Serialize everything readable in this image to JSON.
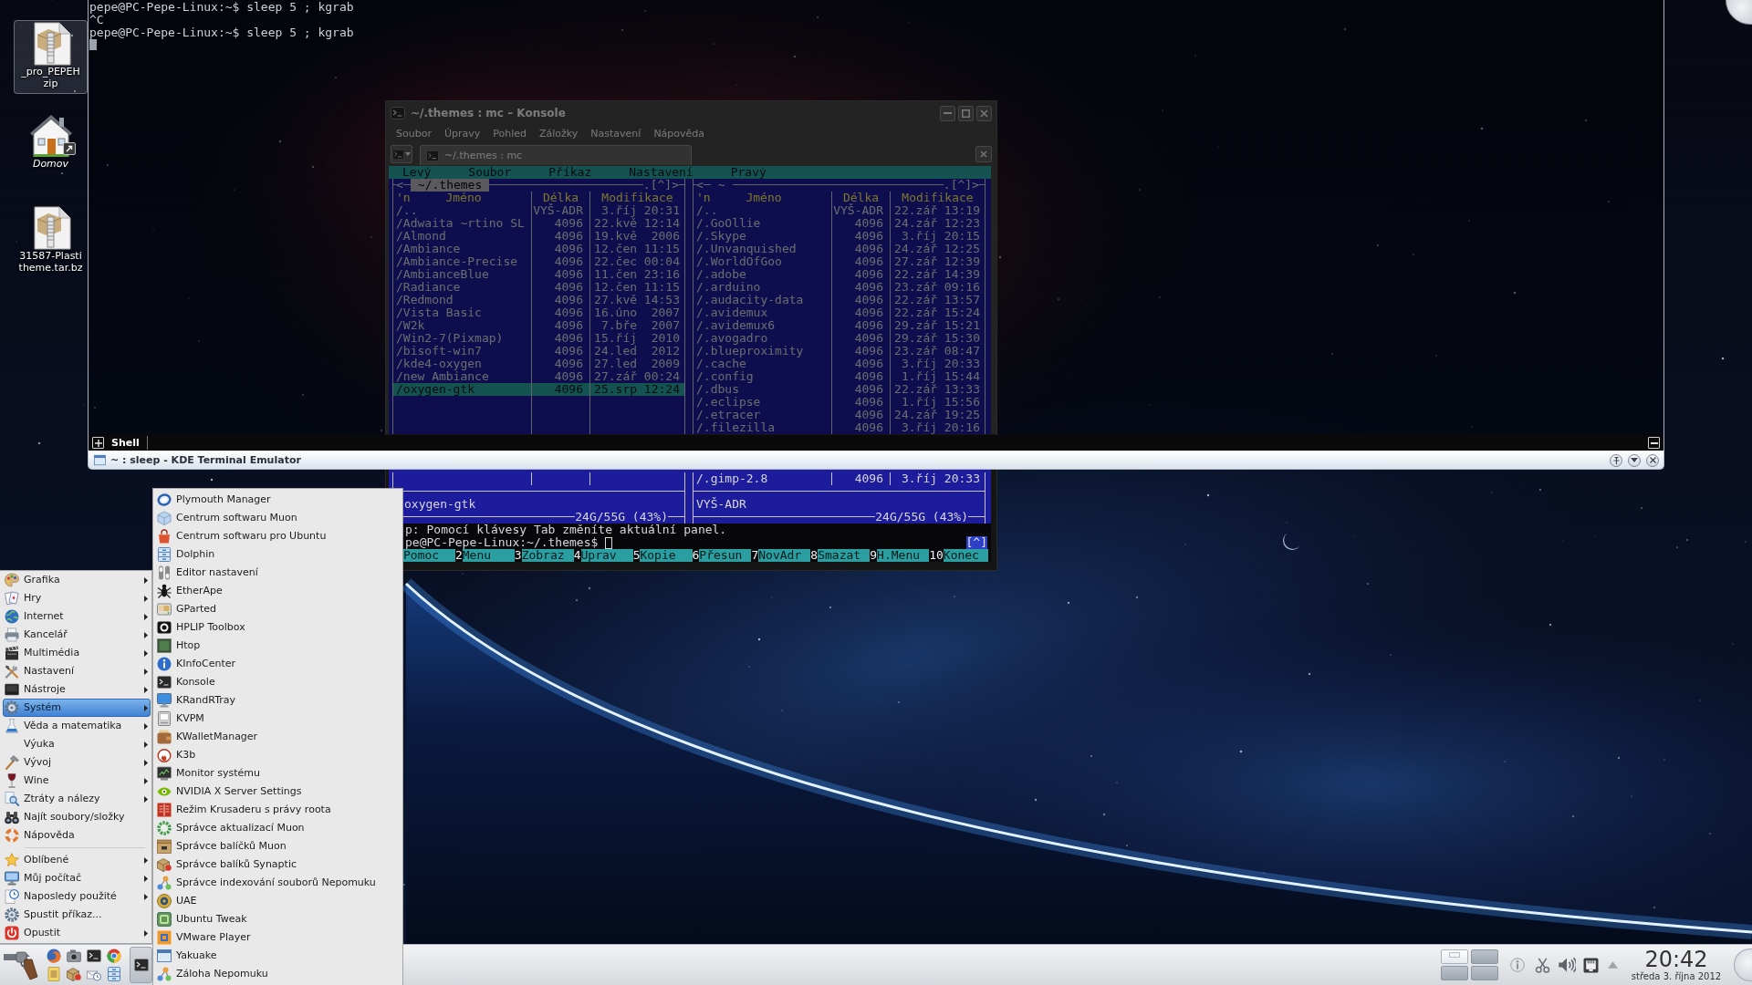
{
  "desktop": {
    "icons": [
      {
        "kind": "archive",
        "label_lines": [
          "_pro_PEPEH",
          "zip"
        ],
        "selected": true,
        "link": false
      },
      {
        "kind": "home",
        "label_lines": [
          "Domov"
        ],
        "selected": false,
        "link": true
      },
      {
        "kind": "archive",
        "label_lines": [
          "31587-Plasti",
          "theme.tar.bz"
        ],
        "selected": false,
        "link": false
      }
    ]
  },
  "yakuake": {
    "terminal_lines": [
      "pepe@PC-Pepe-Linux:~$ sleep 5 ; kgrab",
      "^C",
      "pepe@PC-Pepe-Linux:~$ sleep 5 ; kgrab"
    ],
    "tabs": [
      {
        "label": "Shell",
        "selected": true
      }
    ],
    "title": "~ : sleep - KDE Terminal Emulator"
  },
  "konsole": {
    "title": "~/.themes : mc – Konsole",
    "menu": [
      "Soubor",
      "Úpravy",
      "Pohled",
      "Záložky",
      "Nastavení",
      "Nápověda"
    ],
    "tabs": [
      {
        "label": "~/.themes : mc",
        "selected": true
      }
    ],
    "mc": {
      "menu": [
        "Levý",
        "Soubor",
        "Příkaz",
        "Nastavení",
        "Pravý"
      ],
      "panels": [
        {
          "corner_left": "<",
          "path": "~/.themes",
          "active": true,
          "corner_right": ".[^]>",
          "columns": [
            "'n",
            "Jméno",
            "Délka",
            "Modifikace"
          ],
          "rows": [
            {
              "name": "/..",
              "size": "VYŠ-ADR",
              "modified": "3.říj 20:31",
              "selected": false
            },
            {
              "name": "/Adwaita ~rtino SL",
              "size": "4096",
              "modified": "22.kvě 12:14",
              "selected": false
            },
            {
              "name": "/Almond",
              "size": "4096",
              "modified": "19.kvě  2006",
              "selected": false
            },
            {
              "name": "/Ambiance",
              "size": "4096",
              "modified": "12.čen 11:15",
              "selected": false
            },
            {
              "name": "/Ambiance-Precise",
              "size": "4096",
              "modified": "22.čec 00:04",
              "selected": false
            },
            {
              "name": "/AmbianceBlue",
              "size": "4096",
              "modified": "11.čen 23:16",
              "selected": false
            },
            {
              "name": "/Radiance",
              "size": "4096",
              "modified": "12.čen 11:15",
              "selected": false
            },
            {
              "name": "/Redmond",
              "size": "4096",
              "modified": "27.kvě 14:53",
              "selected": false
            },
            {
              "name": "/Vista Basic",
              "size": "4096",
              "modified": "16.úno  2007",
              "selected": false
            },
            {
              "name": "/W2k",
              "size": "4096",
              "modified": "7.bře  2007",
              "selected": false
            },
            {
              "name": "/Win2-7(Pixmap)",
              "size": "4096",
              "modified": "15.říj  2010",
              "selected": false
            },
            {
              "name": "/bisoft-win7",
              "size": "4096",
              "modified": "24.led  2012",
              "selected": false
            },
            {
              "name": "/kde4-oxygen",
              "size": "4096",
              "modified": "27.led  2009",
              "selected": false
            },
            {
              "name": "/new Ambiance",
              "size": "4096",
              "modified": "27.zář 00:24",
              "selected": false
            },
            {
              "name": "/oxygen-gtk",
              "size": "4096",
              "modified": "25.srp 12:24",
              "selected": true
            }
          ],
          "mini_status": "oxygen-gtk",
          "disk_usage": "24G/55G (43%)"
        },
        {
          "corner_left": "<",
          "path": "~",
          "active": false,
          "corner_right": ".[^]>",
          "columns": [
            "'n",
            "Jméno",
            "Délka",
            "Modifikace"
          ],
          "rows": [
            {
              "name": "/..",
              "size": "VYŠ-ADR",
              "modified": "22.zář 13:19",
              "selected": false
            },
            {
              "name": "/.GoOllie",
              "size": "4096",
              "modified": "24.zář 12:23",
              "selected": false
            },
            {
              "name": "/.Skype",
              "size": "4096",
              "modified": "3.říj 20:15",
              "selected": false
            },
            {
              "name": "/.Unvanquished",
              "size": "4096",
              "modified": "24.zář 12:25",
              "selected": false
            },
            {
              "name": "/.WorldOfGoo",
              "size": "4096",
              "modified": "27.zář 12:39",
              "selected": false
            },
            {
              "name": "/.adobe",
              "size": "4096",
              "modified": "22.zář 14:39",
              "selected": false
            },
            {
              "name": "/.arduino",
              "size": "4096",
              "modified": "23.zář 09:16",
              "selected": false
            },
            {
              "name": "/.audacity-data",
              "size": "4096",
              "modified": "22.zář 13:57",
              "selected": false
            },
            {
              "name": "/.avidemux",
              "size": "4096",
              "modified": "22.zář 15:24",
              "selected": false
            },
            {
              "name": "/.avidemux6",
              "size": "4096",
              "modified": "29.zář 15:21",
              "selected": false
            },
            {
              "name": "/.avogadro",
              "size": "4096",
              "modified": "29.zář 15:30",
              "selected": false
            },
            {
              "name": "/.blueproximity",
              "size": "4096",
              "modified": "23.zář 08:47",
              "selected": false
            },
            {
              "name": "/.cache",
              "size": "4096",
              "modified": "3.říj 20:33",
              "selected": false
            },
            {
              "name": "/.config",
              "size": "4096",
              "modified": "1.říj 15:44",
              "selected": false
            },
            {
              "name": "/.dbus",
              "size": "4096",
              "modified": "22.zář 13:33",
              "selected": false
            },
            {
              "name": "/.eclipse",
              "size": "4096",
              "modified": "1.říj 15:56",
              "selected": false
            },
            {
              "name": "/.etracer",
              "size": "4096",
              "modified": "24.zář 19:25",
              "selected": false
            },
            {
              "name": "/.filezilla",
              "size": "4096",
              "modified": "3.říj 20:16",
              "selected": false
            }
          ],
          "rows_below_bar": [
            {
              "name": "/.gimp-2.8",
              "size": "4096",
              "modified": "3.říj 20:33",
              "selected": false
            }
          ],
          "mini_status": "VYŠ-ADR",
          "disk_usage": "24G/55G (43%)"
        }
      ],
      "hint": "p: Pomocí klávesy Tab změníte aktuální panel.",
      "prompt": "pe@PC-Pepe-Linux:~/.themes$",
      "history_marker": "[^]",
      "function_keys": [
        {
          "label": "Pomoc"
        },
        {
          "key": "2",
          "label": "Menu"
        },
        {
          "key": "3",
          "label": "Zobraz"
        },
        {
          "key": "4",
          "label": "Uprav"
        },
        {
          "key": "5",
          "label": "Kopie"
        },
        {
          "key": "6",
          "label": "Přesun"
        },
        {
          "key": "7",
          "label": "NovAdr"
        },
        {
          "key": "8",
          "label": "Smazat"
        },
        {
          "key": "9",
          "label": "H.Menu"
        },
        {
          "key": "10",
          "label": "Konec"
        }
      ]
    }
  },
  "start_menu": {
    "groups": [
      [
        {
          "label": "Grafika",
          "has_submenu": true,
          "selected": false
        },
        {
          "label": "Hry",
          "has_submenu": true,
          "selected": false
        },
        {
          "label": "Internet",
          "has_submenu": true,
          "selected": false
        },
        {
          "label": "Kancelář",
          "has_submenu": true,
          "selected": false
        },
        {
          "label": "Multimédia",
          "has_submenu": true,
          "selected": false
        },
        {
          "label": "Nastavení",
          "has_submenu": true,
          "selected": false
        },
        {
          "label": "Nástroje",
          "has_submenu": true,
          "selected": false
        },
        {
          "label": "Systém",
          "has_submenu": true,
          "selected": true
        },
        {
          "label": "Věda a matematika",
          "has_submenu": true,
          "selected": false
        },
        {
          "label": "Výuka",
          "has_submenu": true,
          "selected": false
        },
        {
          "label": "Vývoj",
          "has_submenu": true,
          "selected": false
        },
        {
          "label": "Wine",
          "has_submenu": true,
          "selected": false
        },
        {
          "label": "Ztráty a nálezy",
          "has_submenu": true,
          "selected": false
        },
        {
          "label": "Najít soubory/složky",
          "has_submenu": false,
          "selected": false
        },
        {
          "label": "Nápověda",
          "has_submenu": false,
          "selected": false
        }
      ],
      [
        {
          "label": "Oblíbené",
          "has_submenu": true,
          "selected": false
        },
        {
          "label": "Můj počítač",
          "has_submenu": true,
          "selected": false
        },
        {
          "label": "Naposledy použité",
          "has_submenu": true,
          "selected": false
        },
        {
          "label": "Spustit příkaz...",
          "has_submenu": false,
          "selected": false
        },
        {
          "label": "Opustit",
          "has_submenu": true,
          "selected": false
        }
      ]
    ],
    "submenu": [
      {
        "label": "Plymouth Manager",
        "selected": false
      },
      {
        "label": "Centrum softwaru Muon",
        "selected": false
      },
      {
        "label": "Centrum softwaru pro Ubuntu",
        "selected": false
      },
      {
        "label": "Dolphin",
        "selected": false
      },
      {
        "label": "Editor nastavení",
        "selected": false
      },
      {
        "label": "EtherApe",
        "selected": false
      },
      {
        "label": "GParted",
        "selected": false
      },
      {
        "label": "HPLIP Toolbox",
        "selected": false
      },
      {
        "label": "Htop",
        "selected": false
      },
      {
        "label": "KInfoCenter",
        "selected": false
      },
      {
        "label": "Konsole",
        "selected": false
      },
      {
        "label": "KRandRTray",
        "selected": false
      },
      {
        "label": "KVPM",
        "selected": false
      },
      {
        "label": "KWalletManager",
        "selected": false
      },
      {
        "label": "K3b",
        "selected": false
      },
      {
        "label": "Monitor systému",
        "selected": false
      },
      {
        "label": "NVIDIA X Server Settings",
        "selected": false
      },
      {
        "label": "Režim Krusaderu s právy roota",
        "selected": false
      },
      {
        "label": "Správce aktualizací Muon",
        "selected": false
      },
      {
        "label": "Správce balíčků Muon",
        "selected": false
      },
      {
        "label": "Správce balíků Synaptic",
        "selected": false
      },
      {
        "label": "Správce indexování souborů Nepomuku",
        "selected": false
      },
      {
        "label": "UAE",
        "selected": false
      },
      {
        "label": "Ubuntu Tweak",
        "selected": false
      },
      {
        "label": "VMware Player",
        "selected": false
      },
      {
        "label": "Yakuake",
        "selected": false
      },
      {
        "label": "Záloha Nepomuku",
        "selected": false
      }
    ]
  },
  "taskbar": {
    "pager": [
      {
        "selected": true
      },
      {
        "selected": false
      },
      {
        "selected": false
      },
      {
        "selected": false
      }
    ],
    "clock": {
      "time": "20:42",
      "date": "středa 3. října 2012"
    }
  }
}
